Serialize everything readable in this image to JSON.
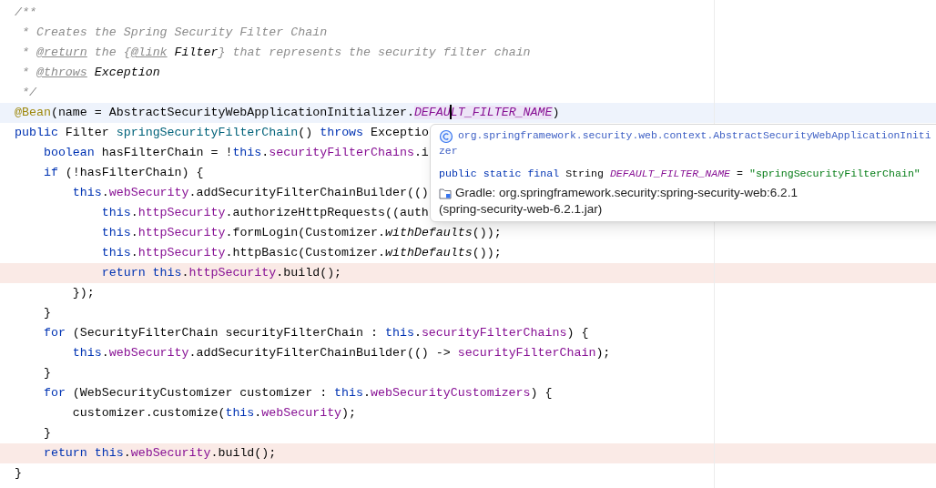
{
  "editor": {
    "lines": [
      {
        "current": false,
        "highlighted": false,
        "tokens": [
          {
            "kind": "comment",
            "text": "/**"
          }
        ]
      },
      {
        "current": false,
        "highlighted": false,
        "tokens": [
          {
            "kind": "comment",
            "text": " * Creates the Spring Security Filter Chain"
          }
        ]
      },
      {
        "current": false,
        "highlighted": false,
        "tokens": [
          {
            "kind": "comment",
            "text": " * "
          },
          {
            "kind": "doctag",
            "text": "@return"
          },
          {
            "kind": "comment",
            "text": " the {"
          },
          {
            "kind": "doctag",
            "text": "@link"
          },
          {
            "kind": "docref",
            "text": " Filter"
          },
          {
            "kind": "comment",
            "text": "} that represents the security filter chain"
          }
        ]
      },
      {
        "current": false,
        "highlighted": false,
        "tokens": [
          {
            "kind": "comment",
            "text": " * "
          },
          {
            "kind": "doctag",
            "text": "@throws"
          },
          {
            "kind": "docref",
            "text": " Exception"
          }
        ]
      },
      {
        "current": false,
        "highlighted": false,
        "tokens": [
          {
            "kind": "comment",
            "text": " */"
          }
        ]
      },
      {
        "current": true,
        "highlighted": false,
        "tokens": [
          {
            "kind": "annotation",
            "text": "@Bean"
          },
          {
            "kind": "plain",
            "text": "(name = AbstractSecurityWebApplicationInitializer."
          },
          {
            "kind": "constant_match",
            "text": "DEFAU"
          },
          {
            "kind": "caret"
          },
          {
            "kind": "constant_match",
            "text": "LT_FILTER_NAME"
          },
          {
            "kind": "plain",
            "text": ")"
          }
        ]
      },
      {
        "current": false,
        "highlighted": false,
        "tokens": [
          {
            "kind": "keyword",
            "text": "public"
          },
          {
            "kind": "plain",
            "text": " Filter "
          },
          {
            "kind": "method",
            "text": "springSecurityFilterChain"
          },
          {
            "kind": "plain",
            "text": "() "
          },
          {
            "kind": "keyword",
            "text": "throws"
          },
          {
            "kind": "plain",
            "text": " Exceptio"
          }
        ]
      },
      {
        "current": false,
        "highlighted": false,
        "tokens": [
          {
            "kind": "keyword",
            "text": "    boolean"
          },
          {
            "kind": "plain",
            "text": " hasFilterChain = !"
          },
          {
            "kind": "keyword",
            "text": "this"
          },
          {
            "kind": "plain",
            "text": "."
          },
          {
            "kind": "field",
            "text": "securityFilterChains"
          },
          {
            "kind": "plain",
            "text": ".i"
          }
        ]
      },
      {
        "current": false,
        "highlighted": false,
        "tokens": [
          {
            "kind": "keyword",
            "text": "    if"
          },
          {
            "kind": "plain",
            "text": " (!hasFilterChain) {"
          }
        ]
      },
      {
        "current": false,
        "highlighted": false,
        "tokens": [
          {
            "kind": "keyword",
            "text": "        this"
          },
          {
            "kind": "plain",
            "text": "."
          },
          {
            "kind": "field",
            "text": "webSecurity"
          },
          {
            "kind": "plain",
            "text": ".addSecurityFilterChainBuilder(()"
          }
        ]
      },
      {
        "current": false,
        "highlighted": false,
        "tokens": [
          {
            "kind": "keyword",
            "text": "            this"
          },
          {
            "kind": "plain",
            "text": "."
          },
          {
            "kind": "field",
            "text": "httpSecurity"
          },
          {
            "kind": "plain",
            "text": ".authorizeHttpRequests((auth"
          }
        ]
      },
      {
        "current": false,
        "highlighted": false,
        "tokens": [
          {
            "kind": "keyword",
            "text": "            this"
          },
          {
            "kind": "plain",
            "text": "."
          },
          {
            "kind": "field",
            "text": "httpSecurity"
          },
          {
            "kind": "plain",
            "text": ".formLogin(Customizer."
          },
          {
            "kind": "static_call",
            "text": "withDefaults"
          },
          {
            "kind": "plain",
            "text": "());"
          }
        ]
      },
      {
        "current": false,
        "highlighted": false,
        "tokens": [
          {
            "kind": "keyword",
            "text": "            this"
          },
          {
            "kind": "plain",
            "text": "."
          },
          {
            "kind": "field",
            "text": "httpSecurity"
          },
          {
            "kind": "plain",
            "text": ".httpBasic(Customizer."
          },
          {
            "kind": "static_call",
            "text": "withDefaults"
          },
          {
            "kind": "plain",
            "text": "());"
          }
        ]
      },
      {
        "current": false,
        "highlighted": true,
        "tokens": [
          {
            "kind": "keyword",
            "text": "            return this"
          },
          {
            "kind": "plain",
            "text": "."
          },
          {
            "kind": "field",
            "text": "httpSecurity"
          },
          {
            "kind": "plain",
            "text": ".build();"
          }
        ]
      },
      {
        "current": false,
        "highlighted": false,
        "tokens": [
          {
            "kind": "plain",
            "text": "        });"
          }
        ]
      },
      {
        "current": false,
        "highlighted": false,
        "tokens": [
          {
            "kind": "plain",
            "text": "    }"
          }
        ]
      },
      {
        "current": false,
        "highlighted": false,
        "tokens": [
          {
            "kind": "keyword",
            "text": "    for"
          },
          {
            "kind": "plain",
            "text": " (SecurityFilterChain securityFilterChain : "
          },
          {
            "kind": "keyword",
            "text": "this"
          },
          {
            "kind": "plain",
            "text": "."
          },
          {
            "kind": "field",
            "text": "securityFilterChains"
          },
          {
            "kind": "plain",
            "text": ") {"
          }
        ]
      },
      {
        "current": false,
        "highlighted": false,
        "tokens": [
          {
            "kind": "keyword",
            "text": "        this"
          },
          {
            "kind": "plain",
            "text": "."
          },
          {
            "kind": "field",
            "text": "webSecurity"
          },
          {
            "kind": "plain",
            "text": ".addSecurityFilterChainBuilder(() -> "
          },
          {
            "kind": "field",
            "text": "securityFilterChain"
          },
          {
            "kind": "plain",
            "text": ");"
          }
        ]
      },
      {
        "current": false,
        "highlighted": false,
        "tokens": [
          {
            "kind": "plain",
            "text": "    }"
          }
        ]
      },
      {
        "current": false,
        "highlighted": false,
        "tokens": [
          {
            "kind": "keyword",
            "text": "    for"
          },
          {
            "kind": "plain",
            "text": " (WebSecurityCustomizer customizer : "
          },
          {
            "kind": "keyword",
            "text": "this"
          },
          {
            "kind": "plain",
            "text": "."
          },
          {
            "kind": "field",
            "text": "webSecurityCustomizers"
          },
          {
            "kind": "plain",
            "text": ") {"
          }
        ]
      },
      {
        "current": false,
        "highlighted": false,
        "tokens": [
          {
            "kind": "plain",
            "text": "        customizer.customize("
          },
          {
            "kind": "keyword",
            "text": "this"
          },
          {
            "kind": "plain",
            "text": "."
          },
          {
            "kind": "field",
            "text": "webSecurity"
          },
          {
            "kind": "plain",
            "text": ");"
          }
        ]
      },
      {
        "current": false,
        "highlighted": false,
        "tokens": [
          {
            "kind": "plain",
            "text": "    }"
          }
        ]
      },
      {
        "current": false,
        "highlighted": true,
        "tokens": [
          {
            "kind": "keyword",
            "text": "    return this"
          },
          {
            "kind": "plain",
            "text": "."
          },
          {
            "kind": "field",
            "text": "webSecurity"
          },
          {
            "kind": "plain",
            "text": ".build();"
          }
        ]
      },
      {
        "current": false,
        "highlighted": false,
        "tokens": [
          {
            "kind": "plain",
            "text": "}"
          }
        ]
      }
    ]
  },
  "doc_popup": {
    "title_lines": [
      "org.springframework.security.web.context.AbstractSecurityWebApplicationIniti",
      "zer"
    ],
    "declaration": [
      {
        "kind": "keyword",
        "text": "public static final"
      },
      {
        "kind": "plain",
        "text": " String "
      },
      {
        "kind": "constant",
        "text": "DEFAULT_FILTER_NAME"
      },
      {
        "kind": "plain",
        "text": " = "
      },
      {
        "kind": "string",
        "text": "\"springSecurityFilterChain\""
      }
    ],
    "library_lines": [
      "Gradle: org.springframework.security:spring-security-web:6.2.1",
      "(spring-security-web-6.2.1.jar)"
    ]
  }
}
